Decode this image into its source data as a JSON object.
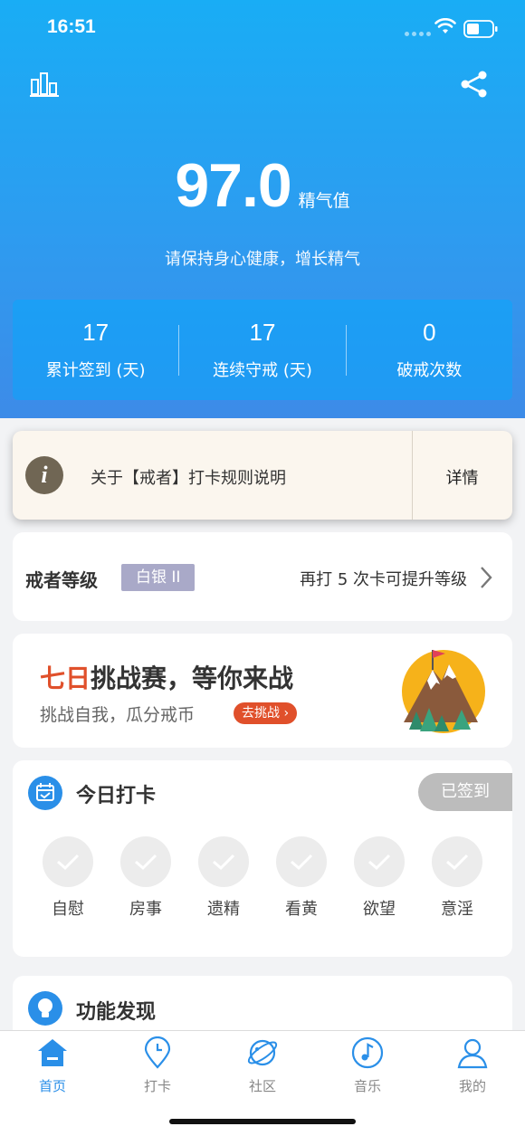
{
  "status_bar": {
    "time": "16:51"
  },
  "header": {
    "value": "97.0",
    "value_unit": "精气值",
    "motto": "请保持身心健康，增长精气"
  },
  "stats": [
    {
      "value": "17",
      "label": "累计签到 (天)"
    },
    {
      "value": "17",
      "label": "连续守戒 (天)"
    },
    {
      "value": "0",
      "label": "破戒次数"
    }
  ],
  "notice": {
    "text": "关于【戒者】打卡规则说明",
    "detail_label": "详情"
  },
  "level": {
    "title": "戒者等级",
    "badge": "白银 II",
    "hint": "再打 5 次卡可提升等级"
  },
  "challenge": {
    "title_highlight": "七日",
    "title_rest": "挑战赛，等你来战",
    "subtitle": "挑战自我，瓜分戒币",
    "button": "去挑战"
  },
  "checkin": {
    "title": "今日打卡",
    "status": "已签到",
    "items": [
      "自慰",
      "房事",
      "遗精",
      "看黄",
      "欲望",
      "意淫"
    ]
  },
  "features": {
    "title": "功能发现"
  },
  "tabbar": [
    {
      "label": "首页",
      "icon": "home-icon",
      "active": true
    },
    {
      "label": "打卡",
      "icon": "location-pin-icon",
      "active": false
    },
    {
      "label": "社区",
      "icon": "planet-icon",
      "active": false
    },
    {
      "label": "音乐",
      "icon": "music-note-icon",
      "active": false
    },
    {
      "label": "我的",
      "icon": "user-icon",
      "active": false
    }
  ],
  "colors": {
    "accent": "#2a8fe8",
    "challenge_red": "#e0502b",
    "badge": "#a9a9c8"
  }
}
